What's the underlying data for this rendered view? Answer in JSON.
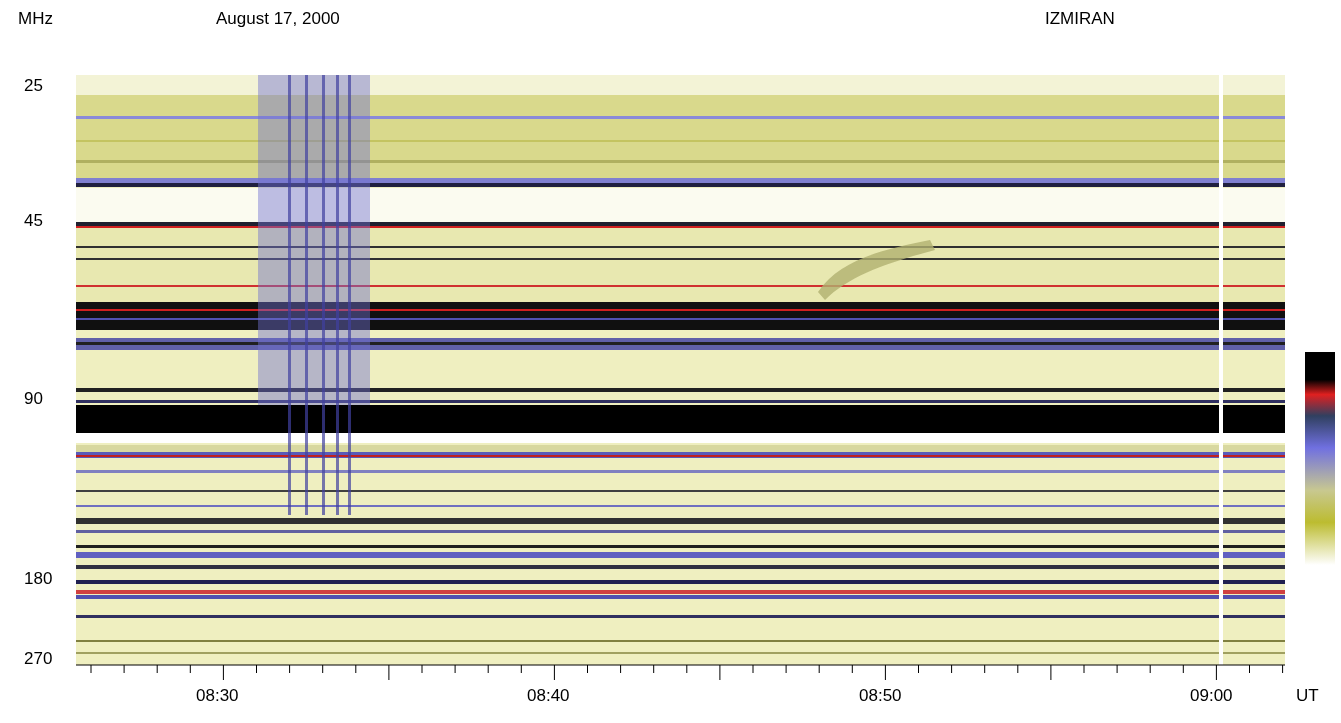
{
  "title": "August 17, 2000",
  "station": "IZMIRAN",
  "y_axis": {
    "unit": "MHz",
    "tick_labels": [
      "25",
      "45",
      "90",
      "180",
      "270"
    ]
  },
  "x_axis": {
    "unit": "UT",
    "tick_labels": [
      "08:30",
      "08:40",
      "08:50",
      "09:00"
    ]
  }
}
